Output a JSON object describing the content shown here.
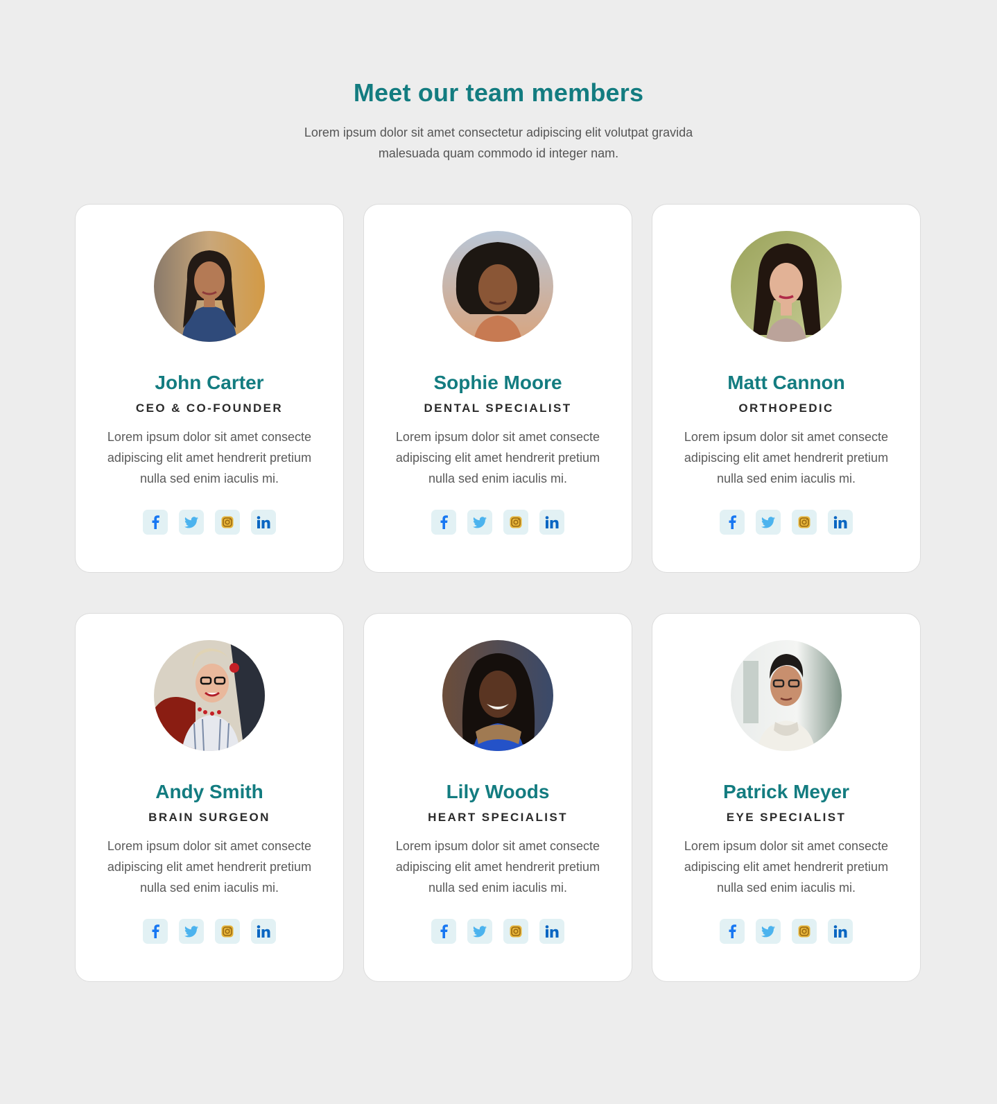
{
  "header": {
    "title": "Meet our team members",
    "subtitle": "Lorem ipsum dolor sit amet consectetur adipiscing elit volutpat gravida malesuada quam commodo id integer nam."
  },
  "colors": {
    "accent": "#137c80",
    "background": "#ededed",
    "icon_bg": "#e2f1f4",
    "facebook": "#1877f2",
    "twitter": "#4cb3ee",
    "instagram": "#d6a42a",
    "linkedin": "#0a66c2"
  },
  "members": [
    {
      "name": "John Carter",
      "role": "CEO & CO-FOUNDER",
      "bio": "Lorem ipsum dolor sit amet consecte adipiscing elit amet hendrerit pretium nulla sed enim iaculis mi.",
      "photo": "portrait-woman-long-dark-hair-outdoor",
      "socials": [
        "facebook-icon",
        "twitter-icon",
        "instagram-icon",
        "linkedin-icon"
      ]
    },
    {
      "name": "Sophie Moore",
      "role": "DENTAL SPECIALIST",
      "bio": "Lorem ipsum dolor sit amet consecte adipiscing elit amet hendrerit pretium nulla sed enim iaculis mi.",
      "photo": "portrait-woman-curly-hair",
      "socials": [
        "facebook-icon",
        "twitter-icon",
        "instagram-icon",
        "linkedin-icon"
      ]
    },
    {
      "name": "Matt Cannon",
      "role": "ORTHOPEDIC",
      "bio": "Lorem ipsum dolor sit amet consecte adipiscing elit amet hendrerit pretium nulla sed enim iaculis mi.",
      "photo": "portrait-woman-dark-hair-green-background",
      "socials": [
        "facebook-icon",
        "twitter-icon",
        "instagram-icon",
        "linkedin-icon"
      ]
    },
    {
      "name": "Andy Smith",
      "role": "BRAIN SURGEON",
      "bio": "Lorem ipsum dolor sit amet consecte adipiscing elit amet hendrerit pretium nulla sed enim iaculis mi.",
      "photo": "portrait-older-woman-glasses",
      "socials": [
        "facebook-icon",
        "twitter-icon",
        "instagram-icon",
        "linkedin-icon"
      ]
    },
    {
      "name": "Lily Woods",
      "role": "HEART SPECIALIST",
      "bio": "Lorem ipsum dolor sit amet consecte adipiscing elit amet hendrerit pretium nulla sed enim iaculis mi.",
      "photo": "portrait-smiling-woman-scarf",
      "socials": [
        "facebook-icon",
        "twitter-icon",
        "instagram-icon",
        "linkedin-icon"
      ]
    },
    {
      "name": "Patrick Meyer",
      "role": "EYE SPECIALIST",
      "bio": "Lorem ipsum dolor sit amet consecte adipiscing elit amet hendrerit pretium nulla sed enim iaculis mi.",
      "photo": "portrait-short-hair-glasses",
      "socials": [
        "facebook-icon",
        "twitter-icon",
        "instagram-icon",
        "linkedin-icon"
      ]
    }
  ]
}
